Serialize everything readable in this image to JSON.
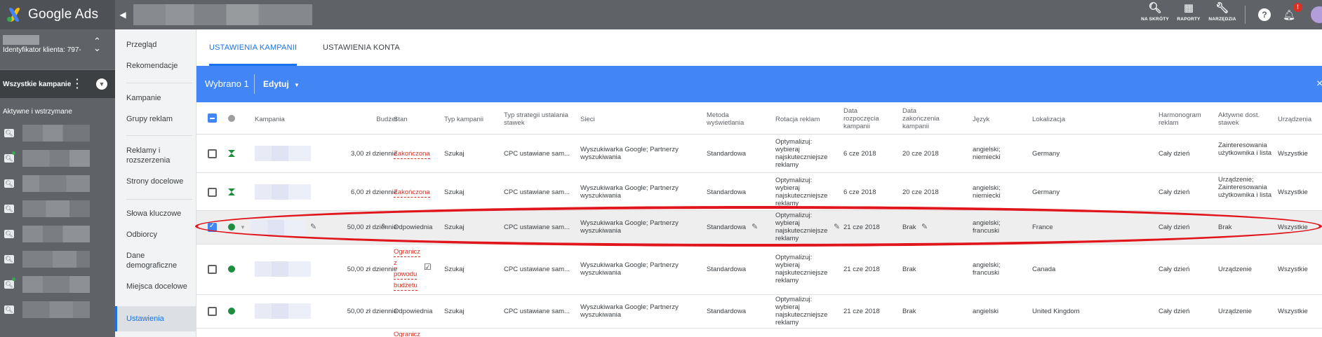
{
  "app": {
    "title": "Google Ads"
  },
  "topbar": {
    "actions": [
      {
        "label": "NA SKRÓTY",
        "icon": "search-icon"
      },
      {
        "label": "RAPORTY",
        "icon": "reports-icon"
      },
      {
        "label": "NARZĘDZIA",
        "icon": "wrench-icon"
      }
    ],
    "notifications_badge": "!"
  },
  "account": {
    "id_label": "Identyfikator klienta: 797-"
  },
  "campaign_selector": {
    "label": "Wszystkie kampanie",
    "status_header": "Aktywne i wstrzymane"
  },
  "nav": {
    "items": [
      {
        "label": "Przegląd"
      },
      {
        "label": "Rekomendacje"
      },
      {
        "label": "Kampanie"
      },
      {
        "label": "Grupy reklam"
      },
      {
        "label": "Reklamy i rozszerzenia"
      },
      {
        "label": "Strony docelowe"
      },
      {
        "label": "Słowa kluczowe"
      },
      {
        "label": "Odbiorcy"
      },
      {
        "label": "Dane demograficzne"
      },
      {
        "label": "Miejsca docelowe"
      },
      {
        "label": "Ustawienia"
      }
    ]
  },
  "tabs": [
    {
      "label": "USTAWIENIA KAMPANII"
    },
    {
      "label": "USTAWIENIA KONTA"
    }
  ],
  "selection_bar": {
    "count_label": "Wybrano 1",
    "edit_label": "Edytuj",
    "close": "×"
  },
  "table": {
    "headers": {
      "campaign": "Kampania",
      "budget": "Budżet",
      "status": "Stan",
      "type": "Typ kampanii",
      "bid_strategy": "Typ strategii ustalania stawek",
      "networks": "Sieci",
      "delivery": "Metoda wyświetlania",
      "rotation": "Rotacja reklam",
      "start": "Data rozpoczęcia kampanii",
      "end": "Data zakończenia kampanii",
      "language": "Język",
      "location": "Lokalizacja",
      "schedule": "Harmonogram reklam",
      "bid_adj": "Aktywne dost. stawek",
      "devices": "Urządzenia"
    },
    "rows": [
      {
        "budget": "3,00 zł dziennie",
        "status": "Zakończona",
        "type": "Szukaj",
        "bid_strategy": "CPC ustawiane sam...",
        "networks": "Wyszukiwarka Google; Partnerzy wyszukiwania",
        "delivery": "Standardowa",
        "rotation": "Optymalizuj: wybieraj najskuteczniejsze reklamy",
        "start": "6 cze 2018",
        "end": "20 cze 2018",
        "language": "angielski; niemiecki",
        "location": "Germany",
        "schedule": "Cały dzień",
        "bid_adj": "Zainteresowania użytkownika i lista",
        "devices": "Wszystkie"
      },
      {
        "budget": "6,00 zł dziennie",
        "status": "Zakończona",
        "type": "Szukaj",
        "bid_strategy": "CPC ustawiane sam...",
        "networks": "Wyszukiwarka Google; Partnerzy wyszukiwania",
        "delivery": "Standardowa",
        "rotation": "Optymalizuj: wybieraj najskuteczniejsze reklamy",
        "start": "6 cze 2018",
        "end": "20 cze 2018",
        "language": "angielski; niemiecki",
        "location": "Germany",
        "schedule": "Cały dzień",
        "bid_adj": "Urządzenie; Zainteresowania użytkownika i lista",
        "devices": "Wszystkie"
      },
      {
        "budget": "50,00 zł dziennie",
        "status": "Odpowiednia",
        "type": "Szukaj",
        "bid_strategy": "CPC ustawiane sam...",
        "networks": "Wyszukiwarka Google; Partnerzy wyszukiwania",
        "delivery": "Standardowa",
        "rotation": "Optymalizuj: wybieraj najskuteczniejsze reklamy",
        "start": "21 cze 2018",
        "end": "Brak",
        "language": "angielski; francuski",
        "location": "France",
        "schedule": "Cały dzień",
        "bid_adj": "Brak",
        "devices": "Wszystkie"
      },
      {
        "budget": "50,00 zł dziennie",
        "status": "Ograniczona z powodu budżetu",
        "status_lines": [
          "Ogranicz",
          "z",
          "powodu",
          "budżetu"
        ],
        "type": "Szukaj",
        "bid_strategy": "CPC ustawiane sam...",
        "networks": "Wyszukiwarka Google; Partnerzy wyszukiwania",
        "delivery": "Standardowa",
        "rotation": "Optymalizuj: wybieraj najskuteczniejsze reklamy",
        "start": "21 cze 2018",
        "end": "Brak",
        "language": "angielski; francuski",
        "location": "Canada",
        "schedule": "Cały dzień",
        "bid_adj": "Urządzenie",
        "devices": "Wszystkie"
      },
      {
        "budget": "50,00 zł dziennie",
        "status": "Odpowiednia",
        "type": "Szukaj",
        "bid_strategy": "CPC ustawiane sam...",
        "networks": "Wyszukiwarka Google; Partnerzy wyszukiwania",
        "delivery": "Standardowa",
        "rotation": "Optymalizuj: wybieraj najskuteczniejsze reklamy",
        "start": "21 cze 2018",
        "end": "Brak",
        "language": "angielski",
        "location": "United Kingdom",
        "schedule": "Cały dzień",
        "bid_adj": "Urządzenie",
        "devices": "Wszystkie"
      },
      {
        "status": "Ogranicz"
      }
    ]
  }
}
